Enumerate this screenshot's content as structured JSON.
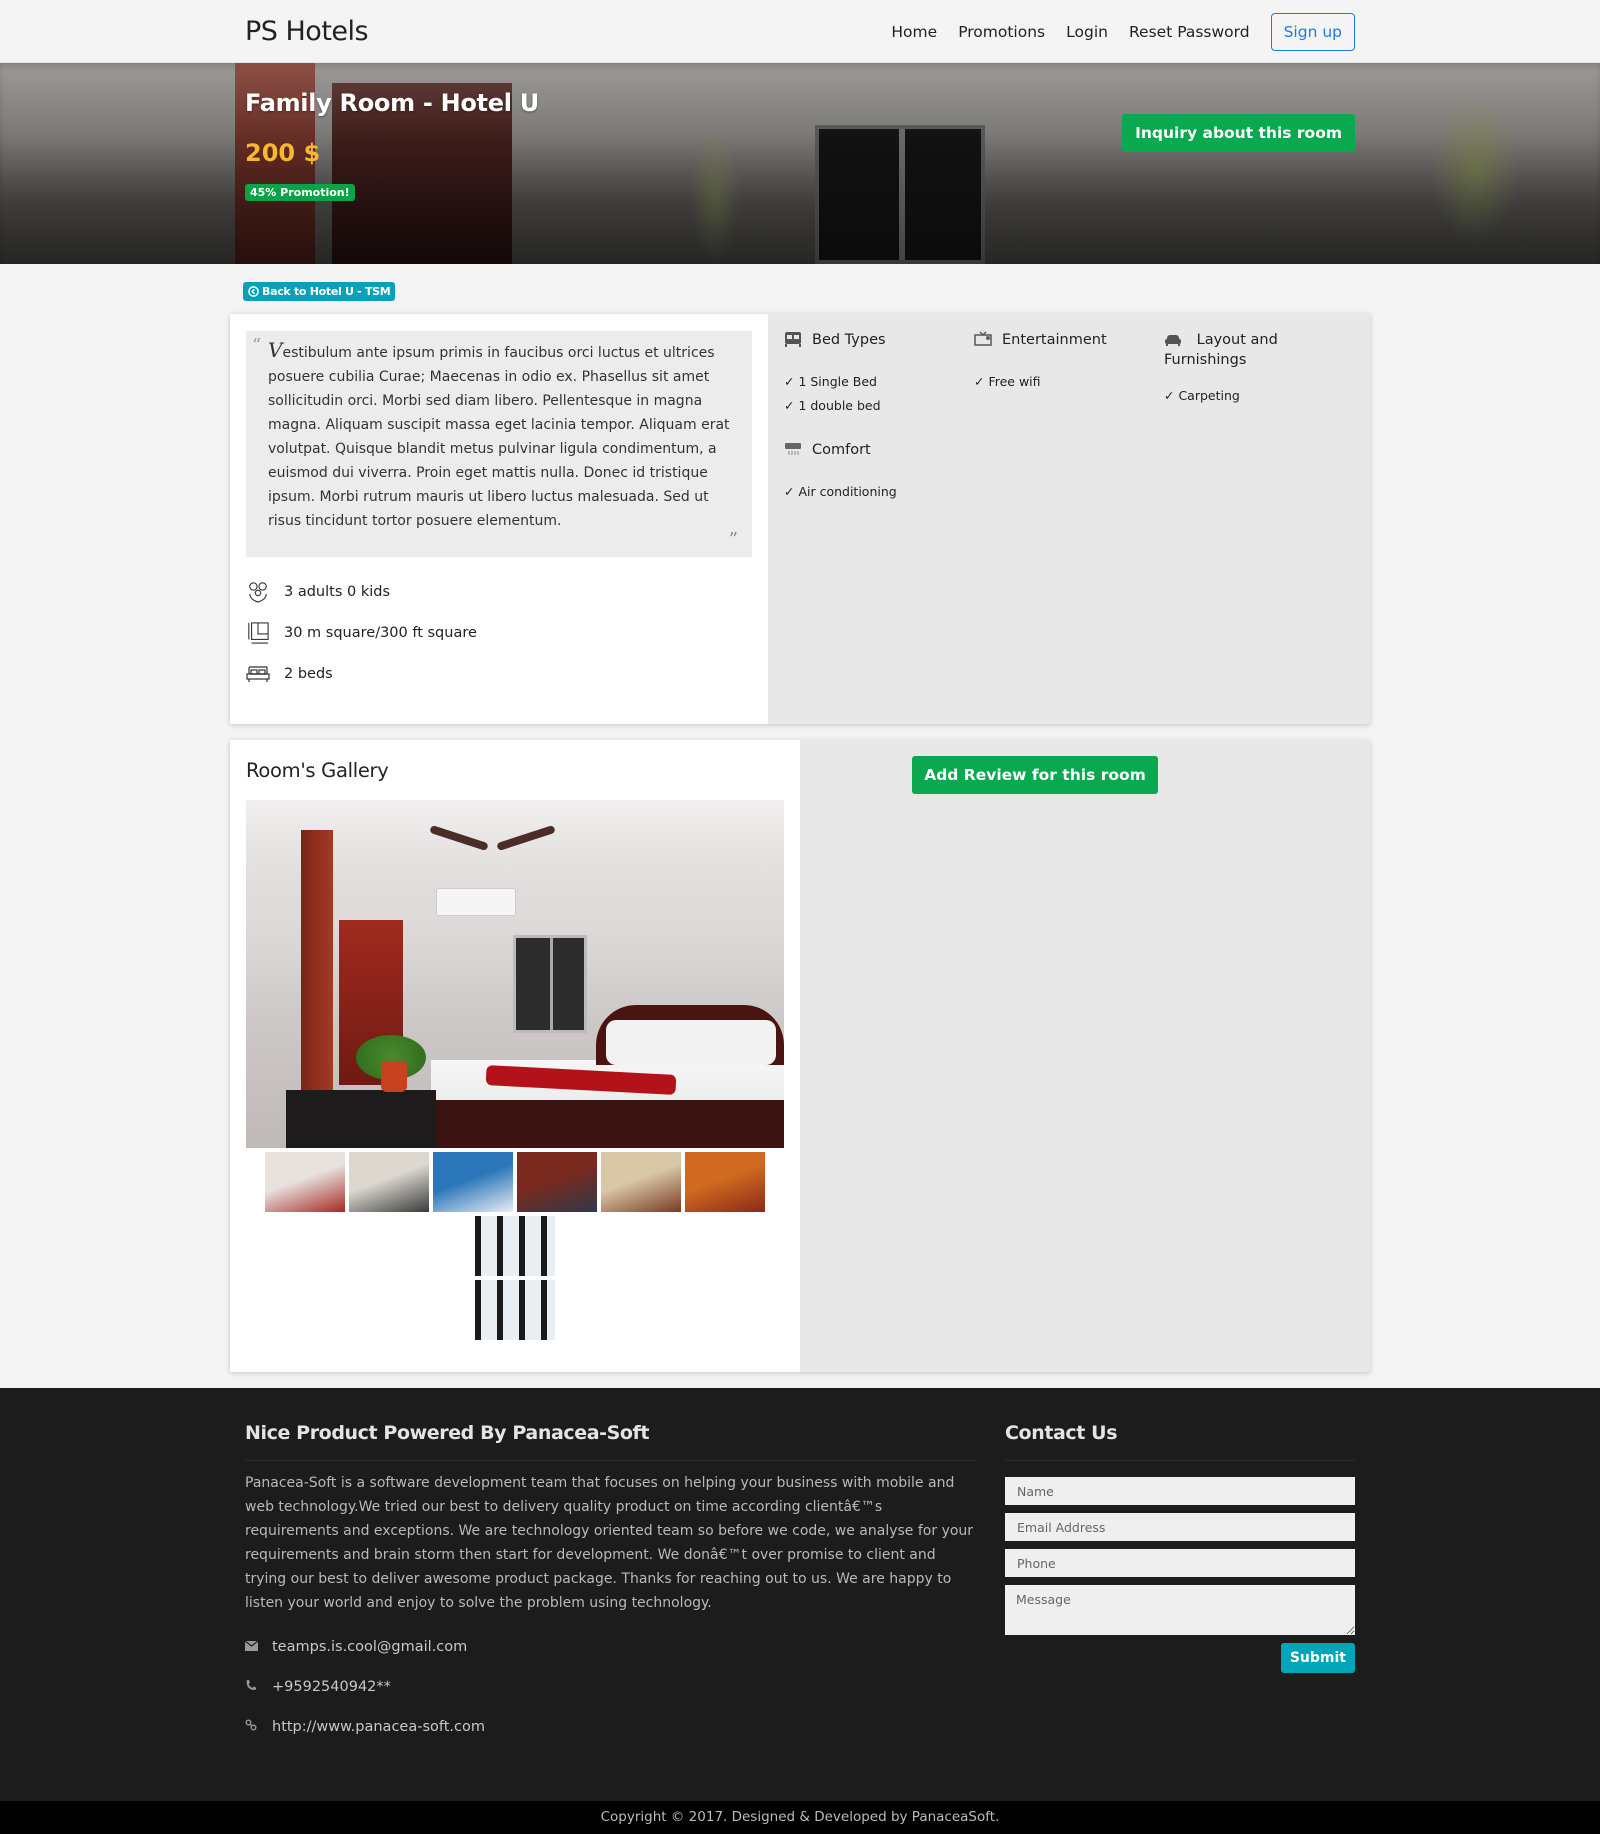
{
  "navbar": {
    "brand": "PS Hotels",
    "links": [
      "Home",
      "Promotions",
      "Login",
      "Reset Password"
    ],
    "signup_label": "Sign up"
  },
  "hero": {
    "room_title": "Family Room - Hotel U",
    "price": "200 $",
    "promotion_badge": "45% Promotion!",
    "inquiry_label": "Inquiry about this room"
  },
  "back_button": {
    "label": "Back to Hotel U - TSM",
    "icon": "circle-arrow-left-icon"
  },
  "room_info": {
    "description_first_letter": "V",
    "description_rest": "estibulum ante ipsum primis in faucibus orci luctus et ultrices posuere cubilia Curae; Maecenas in odio ex. Phasellus sit amet sollicitudin orci. Morbi sed diam libero. Pellentesque in magna magna. Aliquam suscipit massa eget lacinia tempor. Aliquam erat volutpat. Quisque blandit metus pulvinar ligula condimentum, a euismod dui viverra. Proin eget mattis nulla. Donec id tristique ipsum. Morbi rutrum mauris ut libero luctus malesuada. Sed ut risus tincidunt tortor posuere elementum.",
    "open_quote": "“",
    "close_quote": "”",
    "facts": [
      {
        "icon": "family-icon",
        "text": "3 adults 0 kids"
      },
      {
        "icon": "floor-plan-icon",
        "text": "30 m square/300 ft square"
      },
      {
        "icon": "bed-icon",
        "text": "2 beds"
      }
    ]
  },
  "amenities": [
    {
      "icon": "bed-icon",
      "title": "Bed Types",
      "items": [
        "✓ 1 Single Bed",
        "✓ 1 double bed"
      ]
    },
    {
      "icon": "tv-icon",
      "title": "Entertainment",
      "items": [
        "✓ Free wifi"
      ]
    },
    {
      "icon": "sofa-icon",
      "title": "Layout and Furnishings",
      "items": [
        "✓ Carpeting"
      ]
    },
    {
      "icon": "air-conditioner-icon",
      "title": "Comfort",
      "items": [
        "✓ Air conditioning"
      ]
    }
  ],
  "gallery": {
    "title": "Room's Gallery",
    "thumbnails": [
      {
        "name": "thumb-room-1",
        "color_a": "#e8e2df",
        "color_b": "#a52a22"
      },
      {
        "name": "thumb-room-2",
        "color_a": "#dcd8d0",
        "color_b": "#3a3a3a"
      },
      {
        "name": "thumb-room-3",
        "color_a": "#2a76b8",
        "color_b": "#e8eef4"
      },
      {
        "name": "thumb-room-4",
        "color_a": "#7a2a1e",
        "color_b": "#2e3848"
      },
      {
        "name": "thumb-room-5",
        "color_a": "#d8c8a8",
        "color_b": "#7a3a22"
      },
      {
        "name": "thumb-room-6",
        "color_a": "#d06a20",
        "color_b": "#8a2a18"
      },
      {
        "name": "thumb-room-7",
        "color_a": "#e8eef2",
        "color_b": "#1a1a1a"
      },
      {
        "name": "thumb-room-8",
        "color_a": "#e8eef2",
        "color_b": "#1a1a1a"
      }
    ],
    "review_label": "Add Review for this room"
  },
  "footer": {
    "about_title": "Nice Product Powered By Panacea-Soft",
    "about_text": "Panacea-Soft is a software development team that focuses on helping your business with mobile and web technology.We tried our best to delivery quality product on time according clientâ€™s requirements and exceptions. We are technology oriented team so before we code, we analyse for your requirements and brain storm then start for development. We donâ€™t over promise to client and trying our best to deliver awesome product package. Thanks for reaching out to us. We are happy to listen your world and enjoy to solve the problem using technology.",
    "email": "teamps.is.cool@gmail.com",
    "phone": "+9592540942**",
    "website": "http://www.panacea-soft.com",
    "contact_title": "Contact Us",
    "form": {
      "name_placeholder": "Name",
      "email_placeholder": "Email Address",
      "phone_placeholder": "Phone",
      "message_placeholder": "Message",
      "submit_label": "Submit"
    },
    "copyright": "Copyright © 2017. Designed & Developed by PanaceaSoft."
  },
  "colors": {
    "accent_green": "#0aa84f",
    "accent_teal": "#00a6b8",
    "link_blue": "#1a7ee0",
    "price_gold": "#f7b731",
    "footer_bg": "#1c1c1c"
  }
}
